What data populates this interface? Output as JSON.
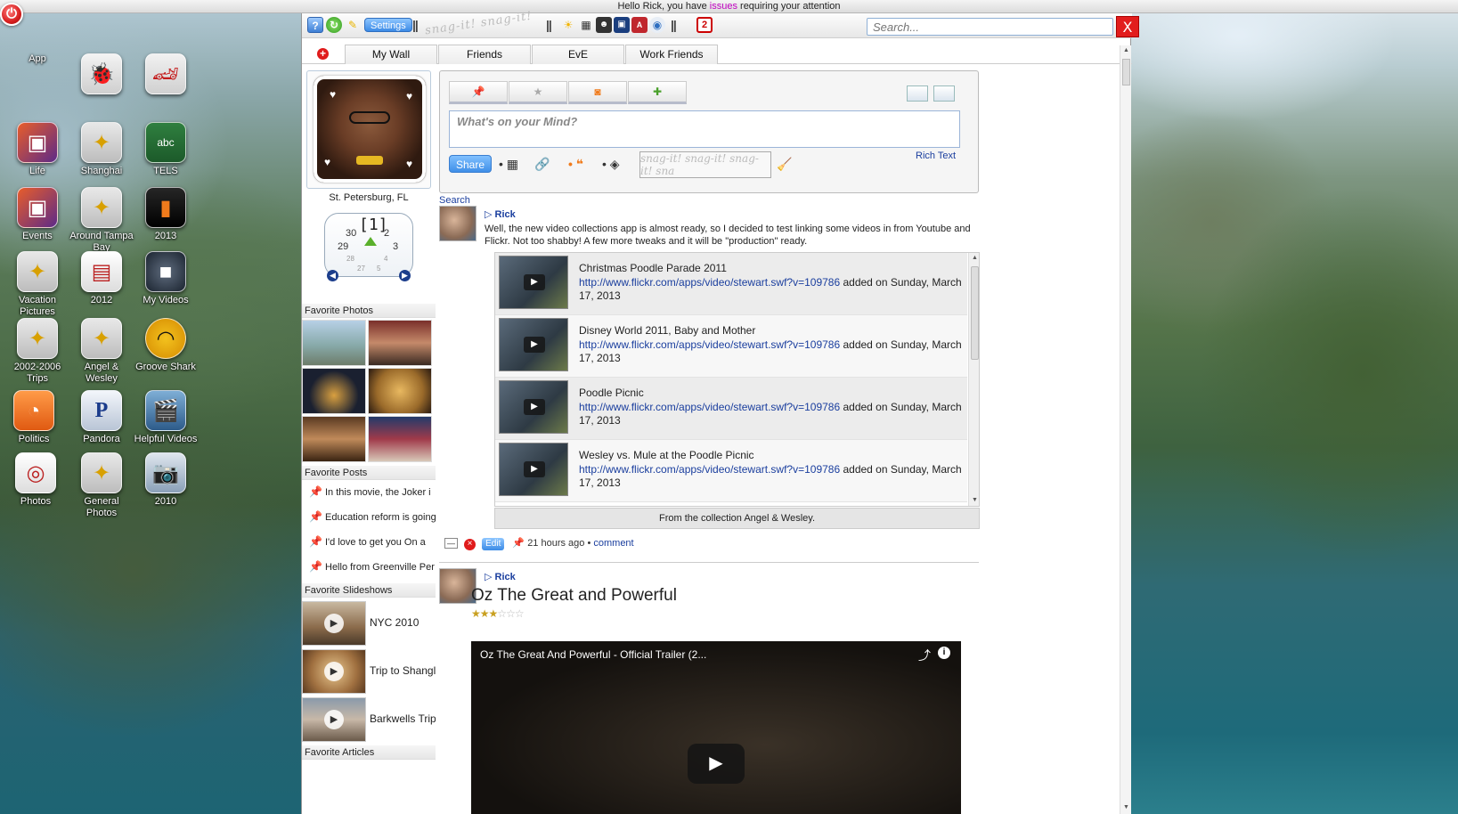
{
  "topbar": {
    "greeting_pre": "Hello Rick, you have ",
    "greeting_link": "issues",
    "greeting_post": " requiring your attention"
  },
  "desktop_icons": [
    {
      "label": "App",
      "icon": "app-store-icon"
    },
    {
      "label": "",
      "icon": "ladybug-icon"
    },
    {
      "label": "",
      "icon": "race-car-icon"
    },
    {
      "label": "Life",
      "icon": "photo-collage-icon"
    },
    {
      "label": "Shanghai",
      "icon": "folder-photo-icon"
    },
    {
      "label": "TELS",
      "icon": "chalkboard-icon"
    },
    {
      "label": "Events",
      "icon": "photo-collage-icon"
    },
    {
      "label": "Around Tampa Bay",
      "icon": "folder-photo-icon"
    },
    {
      "label": "2013",
      "icon": "photo-icon"
    },
    {
      "label": "Vacation Pictures",
      "icon": "folder-photo-icon"
    },
    {
      "label": "2012",
      "icon": "photo-stack-icon"
    },
    {
      "label": "My Videos",
      "icon": "video-camera-icon"
    },
    {
      "label": "2002-2006 Trips",
      "icon": "folder-photo-icon"
    },
    {
      "label": "Angel & Wesley",
      "icon": "folder-photo-icon"
    },
    {
      "label": "Groove Shark",
      "icon": "headphones-icon"
    },
    {
      "label": "Politics",
      "icon": "rss-icon"
    },
    {
      "label": "Pandora",
      "icon": "pandora-icon"
    },
    {
      "label": "Helpful Videos",
      "icon": "clapperboard-icon"
    },
    {
      "label": "Photos",
      "icon": "photos-icon"
    },
    {
      "label": "General Photos",
      "icon": "folder-photo-icon"
    },
    {
      "label": "2010",
      "icon": "camera-icon"
    }
  ],
  "toolbar": {
    "settings_label": "Settings",
    "snag_text": "snag-it! snag-it! snag-it!",
    "search_placeholder": "Search...",
    "close_label": "X",
    "badge_number": "2"
  },
  "tabs": [
    {
      "label": "My Wall"
    },
    {
      "label": "Friends"
    },
    {
      "label": "EvE"
    },
    {
      "label": "Work Friends"
    }
  ],
  "sidebar": {
    "location": "St. Petersburg, FL",
    "clock": {
      "big": "[1]",
      "n30": "30",
      "n2": "2",
      "n29": "29",
      "n3": "3",
      "s28": "28",
      "s4": "4",
      "s27": "27",
      "s5": "5"
    },
    "favorite_photos_heading": "Favorite Photos",
    "favorite_posts_heading": "Favorite Posts",
    "favorite_posts": [
      "In this movie, the Joker i",
      "Education reform is going",
      "I'd love to get you On a",
      "Hello from Greenville Per"
    ],
    "favorite_slideshows_heading": "Favorite Slideshows",
    "slideshows": [
      "NYC 2010",
      "Trip to Shangl",
      "Barkwells Trip"
    ],
    "favorite_articles_heading": "Favorite Articles"
  },
  "composer": {
    "placeholder": "What's on your Mind?",
    "share_label": "Share",
    "rich_text_label": "Rich Text",
    "snag_text": "snag-it! snag-it! snag-it! sna"
  },
  "search_link": "Search",
  "post1": {
    "author": "Rick",
    "text": "Well, the new video collections app is almost ready, so I decided to test linking some videos in from Youtube and Flickr. Not too shabby! A few more tweaks and it will be \"production\" ready.",
    "videos": [
      {
        "title": "Christmas Poodle Parade 2011",
        "url": "http://www.flickr.com/apps/video/stewart.swf?v=109786",
        "added": " added on Sunday, March 17, 2013"
      },
      {
        "title": "Disney World 2011, Baby and Mother",
        "url": "http://www.flickr.com/apps/video/stewart.swf?v=109786",
        "added": " added on Sunday, March 17, 2013"
      },
      {
        "title": "Poodle Picnic",
        "url": "http://www.flickr.com/apps/video/stewart.swf?v=109786",
        "added": " added on Sunday, March 17, 2013"
      },
      {
        "title": "Wesley vs. Mule at the Poodle Picnic",
        "url": "http://www.flickr.com/apps/video/stewart.swf?v=109786",
        "added": " added on Sunday, March 17, 2013"
      }
    ],
    "collection_caption": "From the collection Angel & Wesley.",
    "edit_label": "Edit",
    "time_ago": "21 hours ago",
    "comment_label": "comment"
  },
  "post2": {
    "author": "Rick",
    "title": "Oz The Great and Powerful",
    "rating": 3,
    "rating_max": 6,
    "video_title": "Oz The Great And Powerful - Official Trailer (2..."
  },
  "colors": {
    "accent_blue": "#3c8be6",
    "close_red": "#e21d1d",
    "link_blue": "#1a3e9e",
    "issues_magenta": "#c000c0"
  }
}
